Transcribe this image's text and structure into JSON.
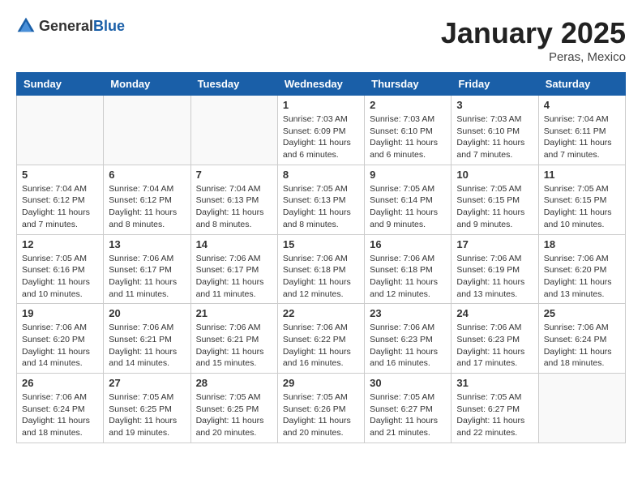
{
  "logo": {
    "text_general": "General",
    "text_blue": "Blue"
  },
  "header": {
    "month": "January 2025",
    "location": "Peras, Mexico"
  },
  "weekdays": [
    "Sunday",
    "Monday",
    "Tuesday",
    "Wednesday",
    "Thursday",
    "Friday",
    "Saturday"
  ],
  "weeks": [
    [
      {
        "day": "",
        "info": ""
      },
      {
        "day": "",
        "info": ""
      },
      {
        "day": "",
        "info": ""
      },
      {
        "day": "1",
        "info": "Sunrise: 7:03 AM\nSunset: 6:09 PM\nDaylight: 11 hours\nand 6 minutes."
      },
      {
        "day": "2",
        "info": "Sunrise: 7:03 AM\nSunset: 6:10 PM\nDaylight: 11 hours\nand 6 minutes."
      },
      {
        "day": "3",
        "info": "Sunrise: 7:03 AM\nSunset: 6:10 PM\nDaylight: 11 hours\nand 7 minutes."
      },
      {
        "day": "4",
        "info": "Sunrise: 7:04 AM\nSunset: 6:11 PM\nDaylight: 11 hours\nand 7 minutes."
      }
    ],
    [
      {
        "day": "5",
        "info": "Sunrise: 7:04 AM\nSunset: 6:12 PM\nDaylight: 11 hours\nand 7 minutes."
      },
      {
        "day": "6",
        "info": "Sunrise: 7:04 AM\nSunset: 6:12 PM\nDaylight: 11 hours\nand 8 minutes."
      },
      {
        "day": "7",
        "info": "Sunrise: 7:04 AM\nSunset: 6:13 PM\nDaylight: 11 hours\nand 8 minutes."
      },
      {
        "day": "8",
        "info": "Sunrise: 7:05 AM\nSunset: 6:13 PM\nDaylight: 11 hours\nand 8 minutes."
      },
      {
        "day": "9",
        "info": "Sunrise: 7:05 AM\nSunset: 6:14 PM\nDaylight: 11 hours\nand 9 minutes."
      },
      {
        "day": "10",
        "info": "Sunrise: 7:05 AM\nSunset: 6:15 PM\nDaylight: 11 hours\nand 9 minutes."
      },
      {
        "day": "11",
        "info": "Sunrise: 7:05 AM\nSunset: 6:15 PM\nDaylight: 11 hours\nand 10 minutes."
      }
    ],
    [
      {
        "day": "12",
        "info": "Sunrise: 7:05 AM\nSunset: 6:16 PM\nDaylight: 11 hours\nand 10 minutes."
      },
      {
        "day": "13",
        "info": "Sunrise: 7:06 AM\nSunset: 6:17 PM\nDaylight: 11 hours\nand 11 minutes."
      },
      {
        "day": "14",
        "info": "Sunrise: 7:06 AM\nSunset: 6:17 PM\nDaylight: 11 hours\nand 11 minutes."
      },
      {
        "day": "15",
        "info": "Sunrise: 7:06 AM\nSunset: 6:18 PM\nDaylight: 11 hours\nand 12 minutes."
      },
      {
        "day": "16",
        "info": "Sunrise: 7:06 AM\nSunset: 6:18 PM\nDaylight: 11 hours\nand 12 minutes."
      },
      {
        "day": "17",
        "info": "Sunrise: 7:06 AM\nSunset: 6:19 PM\nDaylight: 11 hours\nand 13 minutes."
      },
      {
        "day": "18",
        "info": "Sunrise: 7:06 AM\nSunset: 6:20 PM\nDaylight: 11 hours\nand 13 minutes."
      }
    ],
    [
      {
        "day": "19",
        "info": "Sunrise: 7:06 AM\nSunset: 6:20 PM\nDaylight: 11 hours\nand 14 minutes."
      },
      {
        "day": "20",
        "info": "Sunrise: 7:06 AM\nSunset: 6:21 PM\nDaylight: 11 hours\nand 14 minutes."
      },
      {
        "day": "21",
        "info": "Sunrise: 7:06 AM\nSunset: 6:21 PM\nDaylight: 11 hours\nand 15 minutes."
      },
      {
        "day": "22",
        "info": "Sunrise: 7:06 AM\nSunset: 6:22 PM\nDaylight: 11 hours\nand 16 minutes."
      },
      {
        "day": "23",
        "info": "Sunrise: 7:06 AM\nSunset: 6:23 PM\nDaylight: 11 hours\nand 16 minutes."
      },
      {
        "day": "24",
        "info": "Sunrise: 7:06 AM\nSunset: 6:23 PM\nDaylight: 11 hours\nand 17 minutes."
      },
      {
        "day": "25",
        "info": "Sunrise: 7:06 AM\nSunset: 6:24 PM\nDaylight: 11 hours\nand 18 minutes."
      }
    ],
    [
      {
        "day": "26",
        "info": "Sunrise: 7:06 AM\nSunset: 6:24 PM\nDaylight: 11 hours\nand 18 minutes."
      },
      {
        "day": "27",
        "info": "Sunrise: 7:05 AM\nSunset: 6:25 PM\nDaylight: 11 hours\nand 19 minutes."
      },
      {
        "day": "28",
        "info": "Sunrise: 7:05 AM\nSunset: 6:25 PM\nDaylight: 11 hours\nand 20 minutes."
      },
      {
        "day": "29",
        "info": "Sunrise: 7:05 AM\nSunset: 6:26 PM\nDaylight: 11 hours\nand 20 minutes."
      },
      {
        "day": "30",
        "info": "Sunrise: 7:05 AM\nSunset: 6:27 PM\nDaylight: 11 hours\nand 21 minutes."
      },
      {
        "day": "31",
        "info": "Sunrise: 7:05 AM\nSunset: 6:27 PM\nDaylight: 11 hours\nand 22 minutes."
      },
      {
        "day": "",
        "info": ""
      }
    ]
  ]
}
